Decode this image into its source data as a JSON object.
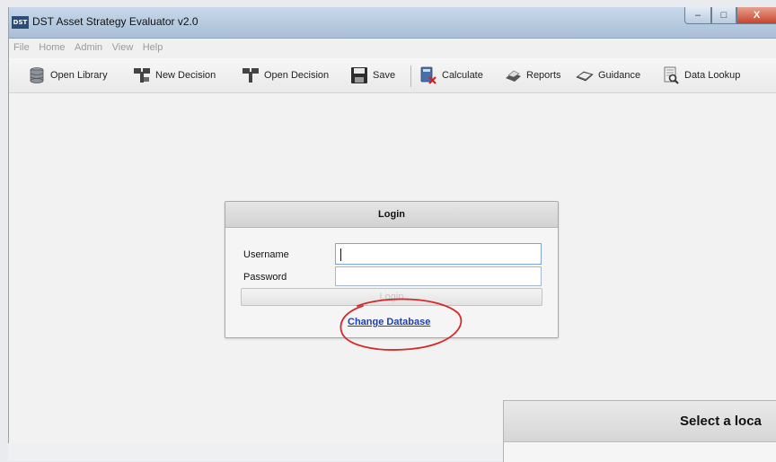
{
  "window": {
    "title": "DST Asset Strategy Evaluator v2.0",
    "logo_text": "DST",
    "controls": {
      "minimize": "–",
      "maximize": "□",
      "close": "X"
    }
  },
  "menu": [
    "File",
    "Home",
    "Admin",
    "View",
    "Help"
  ],
  "toolbar": {
    "open_library": "Open Library",
    "new_decision": "New Decision",
    "open_decision": "Open Decision",
    "save": "Save",
    "calculate": "Calculate",
    "reports": "Reports",
    "guidance": "Guidance",
    "data_lookup": "Data Lookup",
    "icons": {
      "open_library": "database-icon",
      "new_decision": "decision-tree-icon",
      "open_decision": "decision-tree-icon",
      "save": "floppy-disk-icon",
      "calculate": "calculator-icon",
      "reports": "printer-icon",
      "guidance": "book-icon",
      "data_lookup": "magnifier-document-icon"
    }
  },
  "login": {
    "title": "Login",
    "username_label": "Username",
    "password_label": "Password",
    "username_value": "",
    "password_value": "",
    "button_label": "Login",
    "change_database_link": "Change Database"
  },
  "select_panel": {
    "title": "Select a loca"
  },
  "colors": {
    "titlebar": "#b5c9de",
    "close_button": "#c8442c",
    "link": "#1d3fb0",
    "annotation_circle": "#d42a2a"
  }
}
